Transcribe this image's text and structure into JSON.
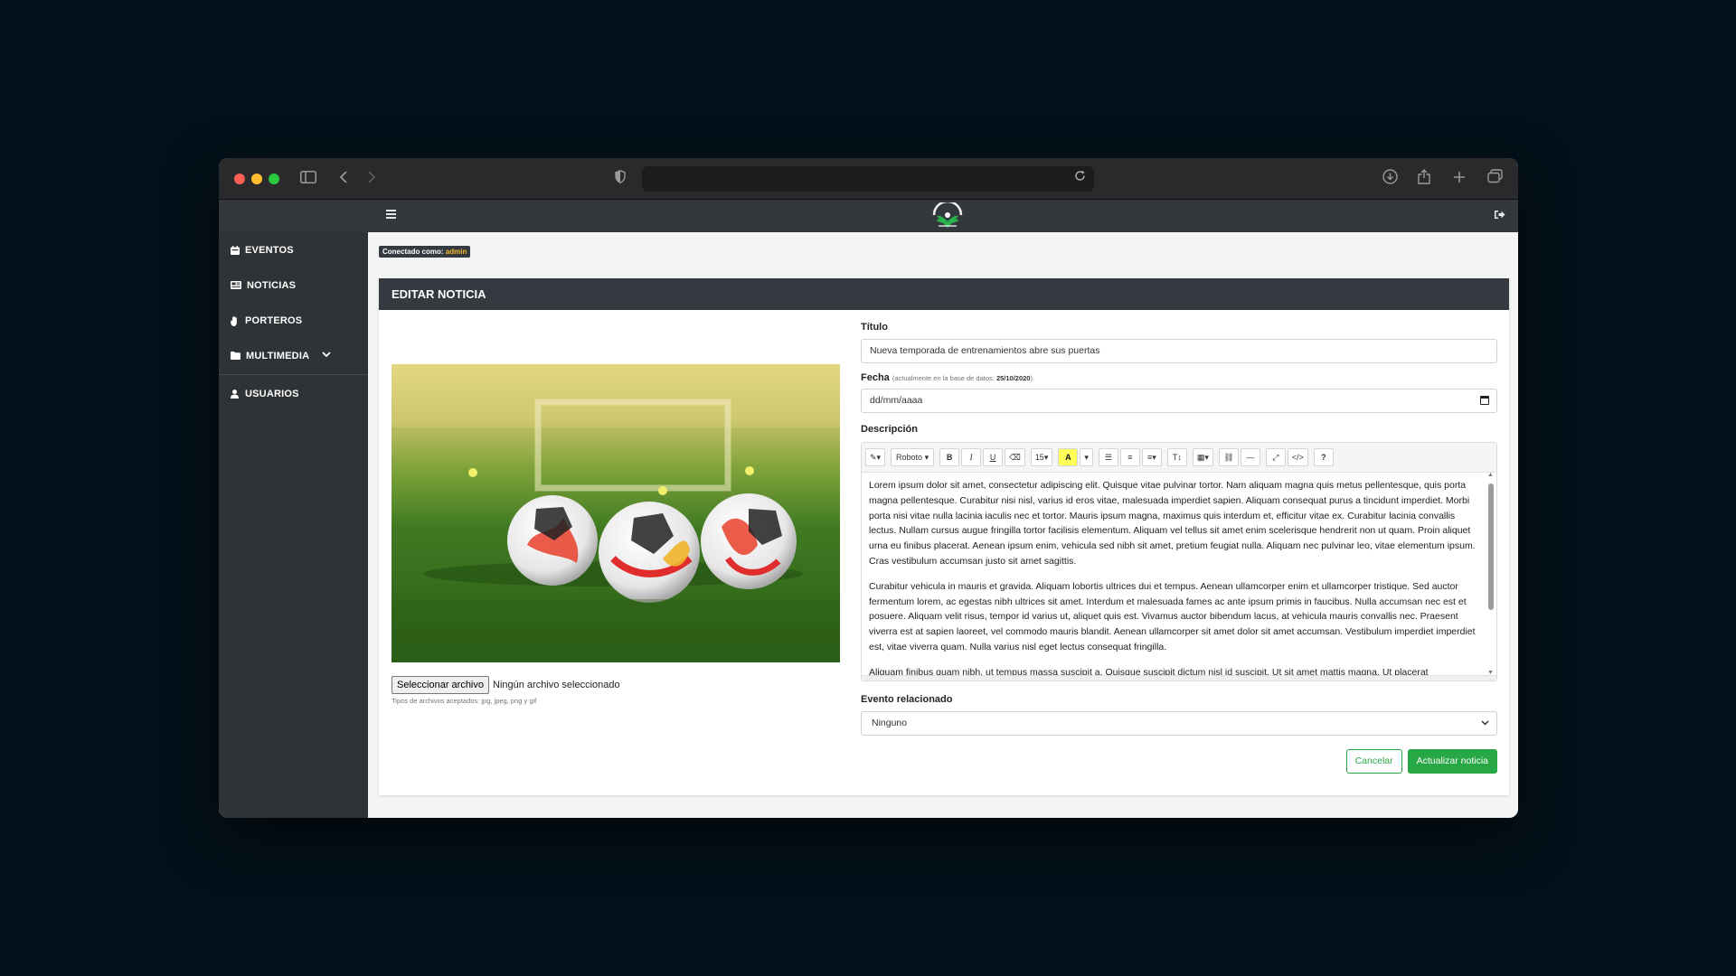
{
  "browser": {
    "url": ""
  },
  "app": {
    "nav": [
      {
        "label": "EVENTOS",
        "icon": "calendar-icon"
      },
      {
        "label": "NOTICIAS",
        "icon": "newspaper-icon"
      },
      {
        "label": "PORTEROS",
        "icon": "hand-icon"
      },
      {
        "label": "MULTIMEDIA",
        "icon": "folder-icon",
        "expandable": true
      },
      {
        "label": "USUARIOS",
        "icon": "user-icon"
      }
    ],
    "connected_label": "Conectado como:",
    "connected_user": "admin"
  },
  "card": {
    "title": "EDITAR NOTICIA",
    "file_button": "Seleccionar archivo",
    "file_status": "Ningún archivo seleccionado",
    "file_hint": "Tipos de archivos aceptados: jpg, jpeg, png y gif"
  },
  "form": {
    "title_label": "Título",
    "title_value": "Nueva temporada de entrenamientos abre sus puertas",
    "date_label": "Fecha",
    "date_note_prefix": "(actualmente en la base de datos: ",
    "date_note_value": "25/10/2020",
    "date_note_suffix": ")",
    "date_placeholder": "dd/mm/aaaa",
    "description_label": "Descripción",
    "toolbar": {
      "font": "Roboto",
      "size": "15"
    },
    "description_paragraphs": [
      "Lorem ipsum dolor sit amet, consectetur adipiscing elit. Quisque vitae pulvinar tortor. Nam aliquam magna quis metus pellentesque, quis porta magna pellentesque. Curabitur nisi nisl, varius id eros vitae, malesuada imperdiet sapien. Aliquam consequat purus a tincidunt imperdiet. Morbi porta nisi vitae nulla lacinia iaculis nec et tortor. Mauris ipsum magna, maximus quis interdum et, efficitur vitae ex. Curabitur lacinia convallis lectus. Nullam cursus augue fringilla tortor facilisis elementum. Aliquam vel tellus sit amet enim scelerisque hendrerit non ut quam. Proin aliquet urna eu finibus placerat. Aenean ipsum enim, vehicula sed nibh sit amet, pretium feugiat nulla. Aliquam nec pulvinar leo, vitae elementum ipsum. Cras vestibulum accumsan justo sit amet sagittis.",
      "Curabitur vehicula in mauris et gravida. Aliquam lobortis ultrices dui et tempus. Aenean ullamcorper enim et ullamcorper tristique. Sed auctor fermentum lorem, ac egestas nibh ultrices sit amet. Interdum et malesuada fames ac ante ipsum primis in faucibus. Nulla accumsan nec est et posuere. Aliquam velit risus, tempor id varius ut, aliquet quis est. Vivamus auctor bibendum lacus, at vehicula mauris convallis nec. Praesent viverra est at sapien laoreet, vel commodo mauris blandit. Aenean ullamcorper sit amet dolor sit amet accumsan. Vestibulum imperdiet imperdiet est, vitae viverra quam. Nulla varius nisl eget lectus consequat fringilla.",
      "Aliquam finibus quam nibh, ut tempus massa suscipit a. Quisque suscipit dictum nisl id suscipit. Ut sit amet mattis magna. Ut placerat"
    ],
    "event_label": "Evento relacionado",
    "event_value": "Ninguno",
    "cancel_label": "Cancelar",
    "submit_label": "Actualizar noticia"
  },
  "colors": {
    "accent": "#28a745",
    "header_dark": "#343a40",
    "sidebar": "#2f3336",
    "badge_user": "#f7b731"
  }
}
